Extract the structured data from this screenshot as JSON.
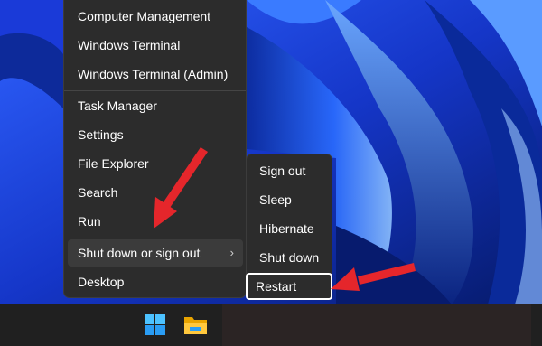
{
  "menu": {
    "items": [
      {
        "label": "Computer Management"
      },
      {
        "label": "Windows Terminal"
      },
      {
        "label": "Windows Terminal (Admin)"
      },
      {
        "label": "Task Manager"
      },
      {
        "label": "Settings"
      },
      {
        "label": "File Explorer"
      },
      {
        "label": "Search"
      },
      {
        "label": "Run"
      },
      {
        "label": "Shut down or sign out"
      },
      {
        "label": "Desktop"
      }
    ],
    "chevron": "›"
  },
  "submenu": {
    "items": [
      {
        "label": "Sign out"
      },
      {
        "label": "Sleep"
      },
      {
        "label": "Hibernate"
      },
      {
        "label": "Shut down"
      },
      {
        "label": "Restart"
      }
    ]
  },
  "taskbar": {
    "icons": [
      "windows-start-icon",
      "file-explorer-icon"
    ]
  },
  "colors": {
    "menu_bg": "#2c2c2c",
    "hover_bg": "#3b3b3b",
    "arrow": "#e5262b",
    "taskbar": "#202020"
  }
}
